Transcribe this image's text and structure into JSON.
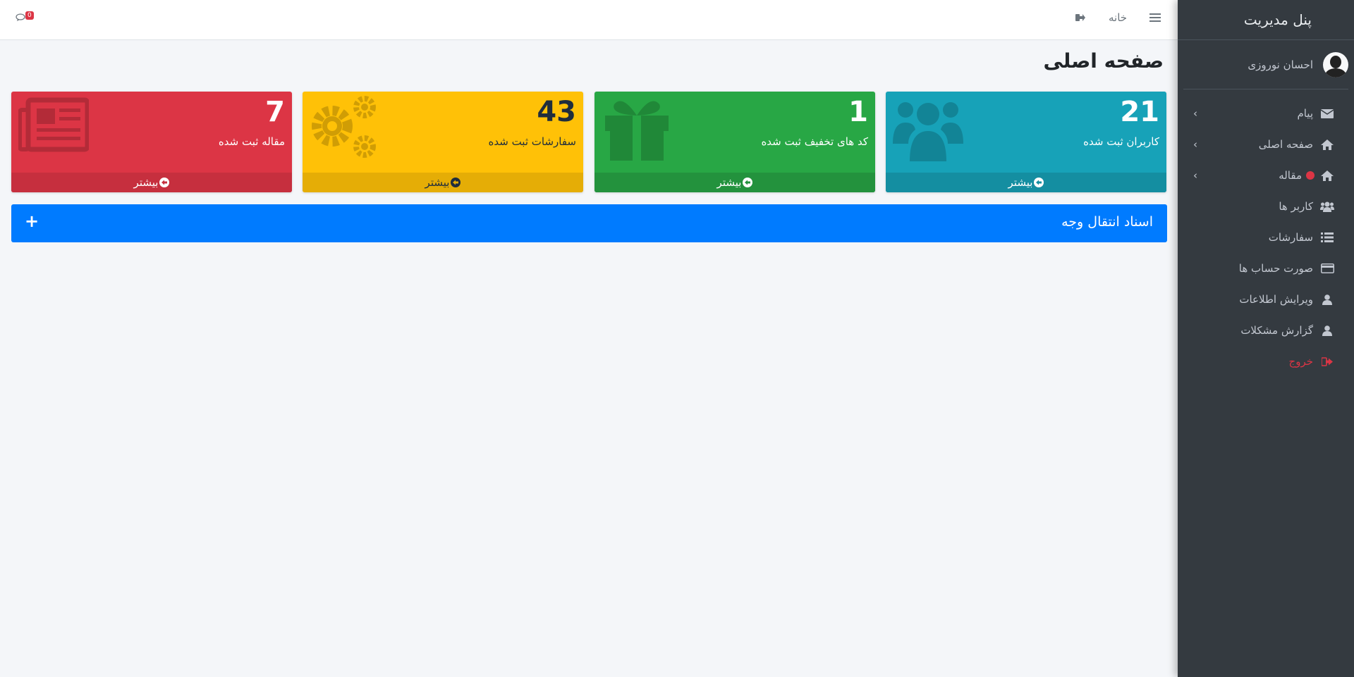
{
  "sidebar": {
    "brand": "پنل مدیریت",
    "user_name": "احسان نوروزی",
    "items": [
      {
        "label": "پیام",
        "icon": "envelope-icon",
        "has_arrow": true
      },
      {
        "label": "صفحه اصلی",
        "icon": "home-icon",
        "has_arrow": true
      },
      {
        "label": "مقاله",
        "icon": "home-icon",
        "has_arrow": true,
        "dot": true
      },
      {
        "label": "کاربر ها",
        "icon": "users-icon"
      },
      {
        "label": "سفارشات",
        "icon": "list-icon"
      },
      {
        "label": "صورت حساب ها",
        "icon": "credit-card-icon"
      },
      {
        "label": "ویرایش اطلاعات",
        "icon": "user-icon"
      },
      {
        "label": "گزارش مشکلات",
        "icon": "user-icon"
      },
      {
        "label": "خروج",
        "icon": "sign-out-icon",
        "color": "#dc3545"
      }
    ]
  },
  "navbar": {
    "home_label": "خانه",
    "chat_badge": "0"
  },
  "page": {
    "title": "صفحه اصلی"
  },
  "boxes": [
    {
      "value": "21",
      "label": "کاربران ثبت شده",
      "more": "بیشتر",
      "color": "#17a2b8",
      "icon": "users-icon"
    },
    {
      "value": "1",
      "label": "کد های تخفیف ثبت شده",
      "more": "بیشتر",
      "color": "#28a745",
      "icon": "gift-icon"
    },
    {
      "value": "43",
      "label": "سفارشات ثبت شده",
      "more": "بیشتر",
      "color": "#ffc107",
      "icon": "gears-icon"
    },
    {
      "value": "7",
      "label": "مقاله ثبت شده",
      "more": "بیشتر",
      "color": "#dc3545",
      "icon": "newspaper-icon"
    }
  ],
  "card": {
    "title": "اسناد انتقال وجه",
    "plus": "+",
    "color": "#007bff"
  }
}
